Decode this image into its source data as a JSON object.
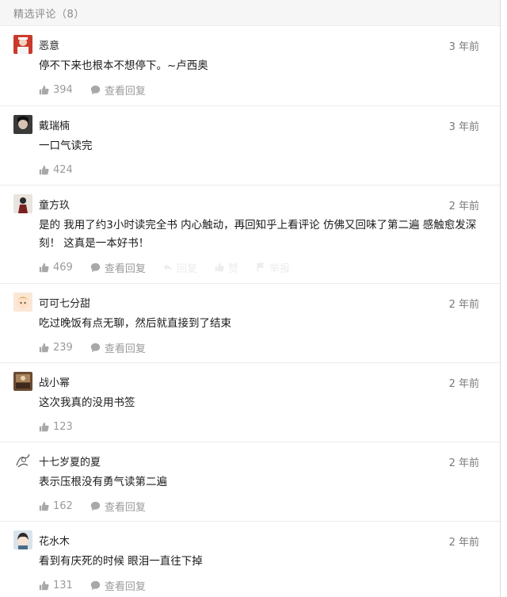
{
  "header": {
    "title": "精选评论（8）"
  },
  "comments": [
    {
      "name": "恶意",
      "time": "3 年前",
      "text": "停不下来也根本不想停下。~卢西奥",
      "likes": "394",
      "reply_label": "查看回复",
      "avatar_icon": "avatar-red-icon"
    },
    {
      "name": "戴瑞楠",
      "time": "3 年前",
      "text": "一口气读完",
      "likes": "424",
      "avatar_icon": "avatar-dark-icon"
    },
    {
      "name": "童方玖",
      "time": "2 年前",
      "text": "是的 我用了约3小时读完全书 内心触动，再回知乎上看评论 仿佛又回味了第二遍 感触愈发深刻！ 这真是一本好书！",
      "likes": "469",
      "reply_label": "查看回复",
      "ghost_actions": [
        "回复",
        "赞",
        "举报"
      ],
      "avatar_icon": "avatar-figure-icon"
    },
    {
      "name": "可可七分甜",
      "time": "2 年前",
      "text": "吃过晚饭有点无聊，然后就直接到了结束",
      "likes": "239",
      "reply_label": "查看回复",
      "avatar_icon": "avatar-cartoon-icon"
    },
    {
      "name": "战小幂",
      "time": "2 年前",
      "text": "这次我真的没用书签",
      "likes": "123",
      "avatar_icon": "avatar-brown-icon"
    },
    {
      "name": "十七岁夏的夏",
      "time": "2 年前",
      "text": "表示压根没有勇气读第二遍",
      "likes": "162",
      "reply_label": "查看回复",
      "avatar_icon": "avatar-sketch-icon"
    },
    {
      "name": "花水木",
      "time": "2 年前",
      "text": "看到有庆死的时候 眼泪一直往下掉",
      "likes": "131",
      "reply_label": "查看回复",
      "avatar_icon": "avatar-anime-icon"
    }
  ],
  "colors": {
    "text": "#1a1a1a",
    "muted": "#9a9a9a",
    "icon": "#a8a8a8",
    "header_bg": "#f6f6f6",
    "divider": "#ececec"
  }
}
